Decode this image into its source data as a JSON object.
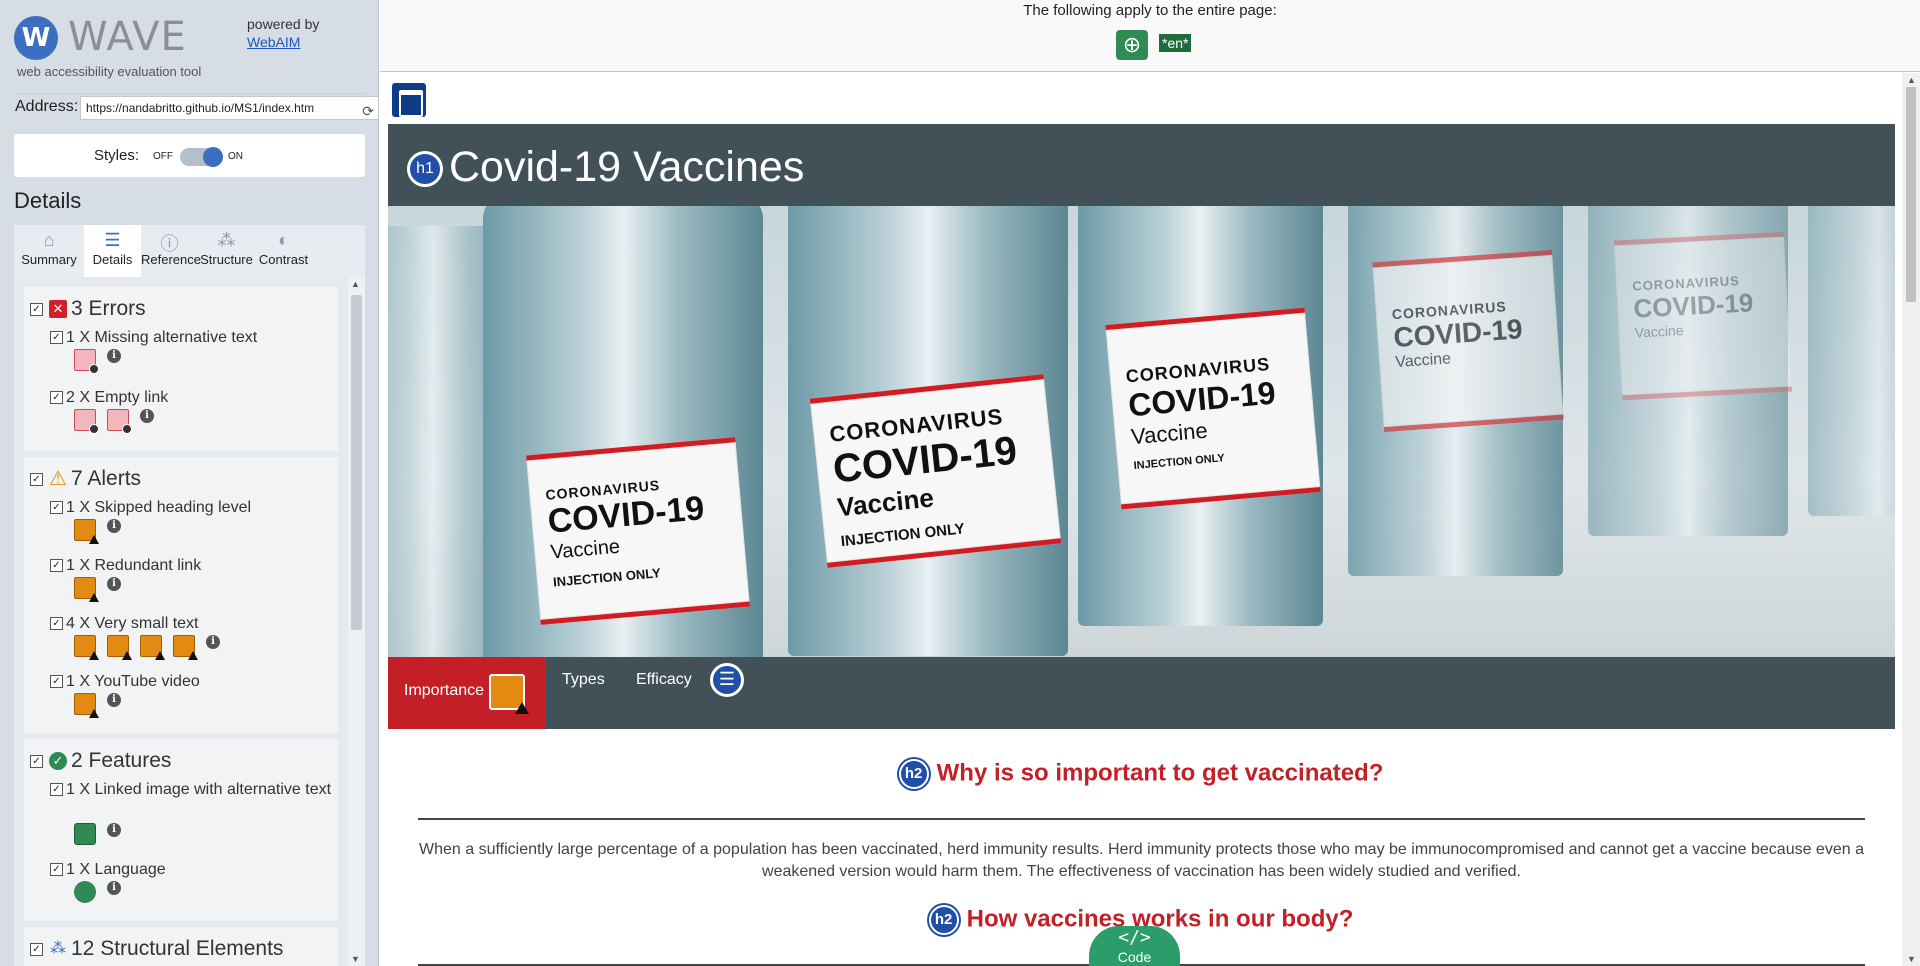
{
  "sidebar": {
    "logo_letter": "W",
    "logo_text": "WAVE",
    "logo_subtitle": "web accessibility evaluation tool",
    "powered_by": "powered by",
    "powered_link": "WebAIM",
    "address_label": "Address:",
    "address_value": "https://nandabritto.github.io/MS1/index.htm",
    "styles_label": "Styles:",
    "styles_off": "OFF",
    "styles_on": "ON",
    "details_title": "Details",
    "tabs": [
      {
        "label": "Summary",
        "icon": "home-icon"
      },
      {
        "label": "Details",
        "icon": "list-icon"
      },
      {
        "label": "Reference",
        "icon": "info-icon"
      },
      {
        "label": "Structure",
        "icon": "hierarchy-icon"
      },
      {
        "label": "Contrast",
        "icon": "contrast-icon"
      }
    ],
    "active_tab": "Details",
    "categories": {
      "errors": {
        "title": "3 Errors",
        "items": [
          {
            "label": "1 X Missing alternative text",
            "count": 1
          },
          {
            "label": "2 X Empty link",
            "count": 2
          }
        ]
      },
      "alerts": {
        "title": "7 Alerts",
        "items": [
          {
            "label": "1 X Skipped heading level",
            "count": 1
          },
          {
            "label": "1 X Redundant link",
            "count": 1
          },
          {
            "label": "4 X Very small text",
            "count": 4
          },
          {
            "label": "1 X YouTube video",
            "count": 1
          }
        ]
      },
      "features": {
        "title": "2 Features",
        "items": [
          {
            "label": "1 X Linked image with alternative text",
            "count": 1
          },
          {
            "label": "1 X Language",
            "count": 1
          }
        ]
      },
      "structural": {
        "title": "12 Structural Elements"
      }
    }
  },
  "main": {
    "notice_text": "The following apply to the entire page:",
    "language_chip": "*en*",
    "site": {
      "h1_badge": "h1",
      "title": "Covid-19 Vaccines",
      "nav": [
        "Importance",
        "Types",
        "Efficacy"
      ],
      "sections": [
        {
          "badge": "h2",
          "heading": "Why is so important to get vaccinated?"
        },
        {
          "badge": "h2",
          "heading": "How vaccines works in our body?"
        }
      ],
      "paragraph": "When a sufficiently large percentage of a population has been vaccinated, herd immunity results. Herd immunity protects those who may be immunocompromised and cannot get a vaccine because even a weakened version would harm them. The effectiveness of vaccination has been widely studied and verified.",
      "hero_labels": [
        {
          "l1": "CORONAVIRUS",
          "l2": "COVID-19",
          "l3": "Vaccine",
          "l4": "INJECTION ONLY"
        },
        {
          "l1": "CORONAVIRUS",
          "l2": "COVID-19",
          "l3": "Vaccine",
          "l4": "INJECTION ONLY"
        },
        {
          "l1": "CORONAVIRUS",
          "l2": "COVID-19",
          "l3": "Vaccine",
          "l4": "INJECTION ONLY"
        },
        {
          "l1": "CORONAVIRUS",
          "l2": "COVID-19",
          "l3": "Vaccine",
          "l4": ""
        },
        {
          "l1": "CORONAVIRUS",
          "l2": "COVID-19",
          "l3": "Vaccine",
          "l4": ""
        }
      ]
    },
    "code_button": "Code",
    "code_icon": "</>"
  },
  "colors": {
    "accent": "#3d6fc0",
    "error": "#d0202c",
    "alert": "#e28a12",
    "feature": "#2f8a54",
    "site_header": "#425158",
    "site_red": "#c41f26"
  }
}
